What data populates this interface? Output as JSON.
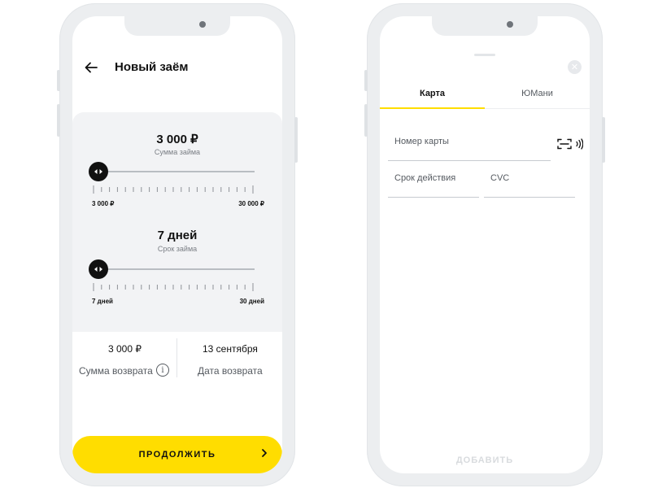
{
  "loan_screen": {
    "title": "Новый заём",
    "amount": {
      "value": "3 000 ₽",
      "caption": "Сумма займа",
      "min_label": "3 000 ₽",
      "max_label": "30 000 ₽",
      "position_fraction": 0
    },
    "term": {
      "value": "7 дней",
      "caption": "Срок займа",
      "min_label": "7 дней",
      "max_label": "30 дней",
      "position_fraction": 0
    },
    "summary": {
      "return_amount": "3 000 ₽",
      "return_amount_label": "Сумма возврата",
      "return_date": "13 сентября",
      "return_date_label": "Дата возврата"
    },
    "continue_label": "ПРОДОЛЖИТЬ",
    "continue_icon": "chevron-right-icon",
    "back_icon": "arrow-left-icon"
  },
  "card_screen": {
    "tabs": [
      {
        "label": "Карта",
        "active": true
      },
      {
        "label": "ЮМани",
        "active": false
      }
    ],
    "fields": {
      "card_number_placeholder": "Номер карты",
      "expiry_placeholder": "Срок действия",
      "cvc_placeholder": "CVC"
    },
    "add_label": "ДОБАВИТЬ",
    "add_enabled": false,
    "icons": [
      "close-icon",
      "card-scan-icon",
      "nfc-icon"
    ]
  },
  "colors": {
    "accent": "#ffdd00",
    "background_card": "#f2f3f5",
    "phone_frame": "#eceef0",
    "text_primary": "#111111",
    "text_secondary": "#555a60",
    "disabled": "#d8dbde"
  }
}
